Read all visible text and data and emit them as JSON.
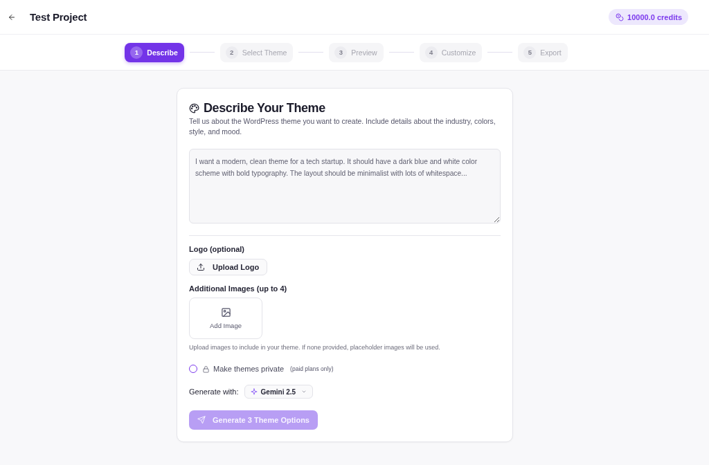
{
  "header": {
    "title": "Test Project",
    "credits": "10000.0 credits"
  },
  "steps": [
    {
      "number": "1",
      "label": "Describe",
      "selected": true
    },
    {
      "number": "2",
      "label": "Select Theme",
      "selected": false
    },
    {
      "number": "3",
      "label": "Preview",
      "selected": false
    },
    {
      "number": "4",
      "label": "Customize",
      "selected": false
    },
    {
      "number": "5",
      "label": "Export",
      "selected": false
    }
  ],
  "form": {
    "title": "Describe Your Theme",
    "description": "Tell us about the WordPress theme you want to create. Include details about the industry, colors, style, and mood.",
    "prompt": {
      "placeholder": "I want a modern, clean theme for a tech startup. It should have a dark blue and white color scheme with bold typography. The layout should be minimalist with lots of whitespace..."
    },
    "logo": {
      "label": "Logo (optional)",
      "button": "Upload Logo"
    },
    "images": {
      "label": "Additional Images (up to 4)",
      "add_button": "Add Image",
      "hint": "Upload images to include in your theme. If none provided, placeholder images will be used."
    },
    "private": {
      "label": "Make themes private",
      "note": "(paid plans only)",
      "checked": false
    },
    "model": {
      "label": "Generate with:",
      "value": "Gemini 2.5"
    },
    "submit": {
      "label": "Generate 3 Theme Options",
      "disabled": true
    }
  }
}
